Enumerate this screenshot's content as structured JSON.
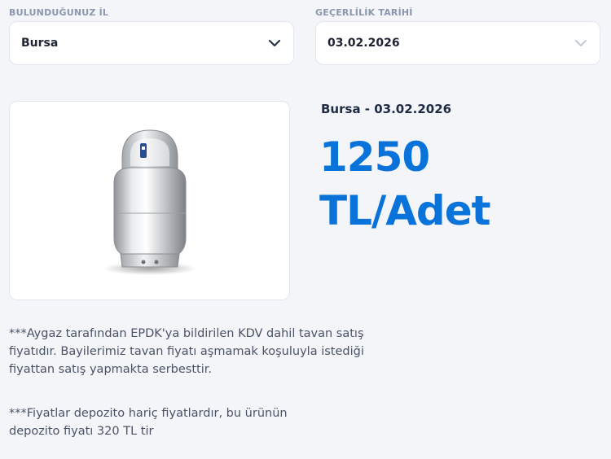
{
  "filters": {
    "province": {
      "label": "BULUNDUĞUNUZ İL",
      "value": "Bursa",
      "icon": "chevron-down-icon"
    },
    "validity_date": {
      "label": "GEÇERLİLİK TARİHİ",
      "value": "03.02.2026",
      "icon": "chevron-down-icon"
    }
  },
  "product": {
    "image": "gas-cylinder-image",
    "price_header": "Bursa - 03.02.2026",
    "price": "1250",
    "unit": "TL/Adet"
  },
  "notes": {
    "note1": "***Aygaz tarafından EPDK'ya bildirilen KDV dahil tavan satış fiyatıdır. Bayilerimiz tavan fiyatı aşmamak koşuluyla istediği fiyattan satış yapmakta serbesttir.",
    "note2": "***Fiyatlar depozito hariç fiyatlardır, bu ürünün depozito fiyatı 320 TL tir"
  },
  "colors": {
    "accent": "#0a73d9",
    "background": "#f3f5f9",
    "label": "#8c97ad"
  }
}
